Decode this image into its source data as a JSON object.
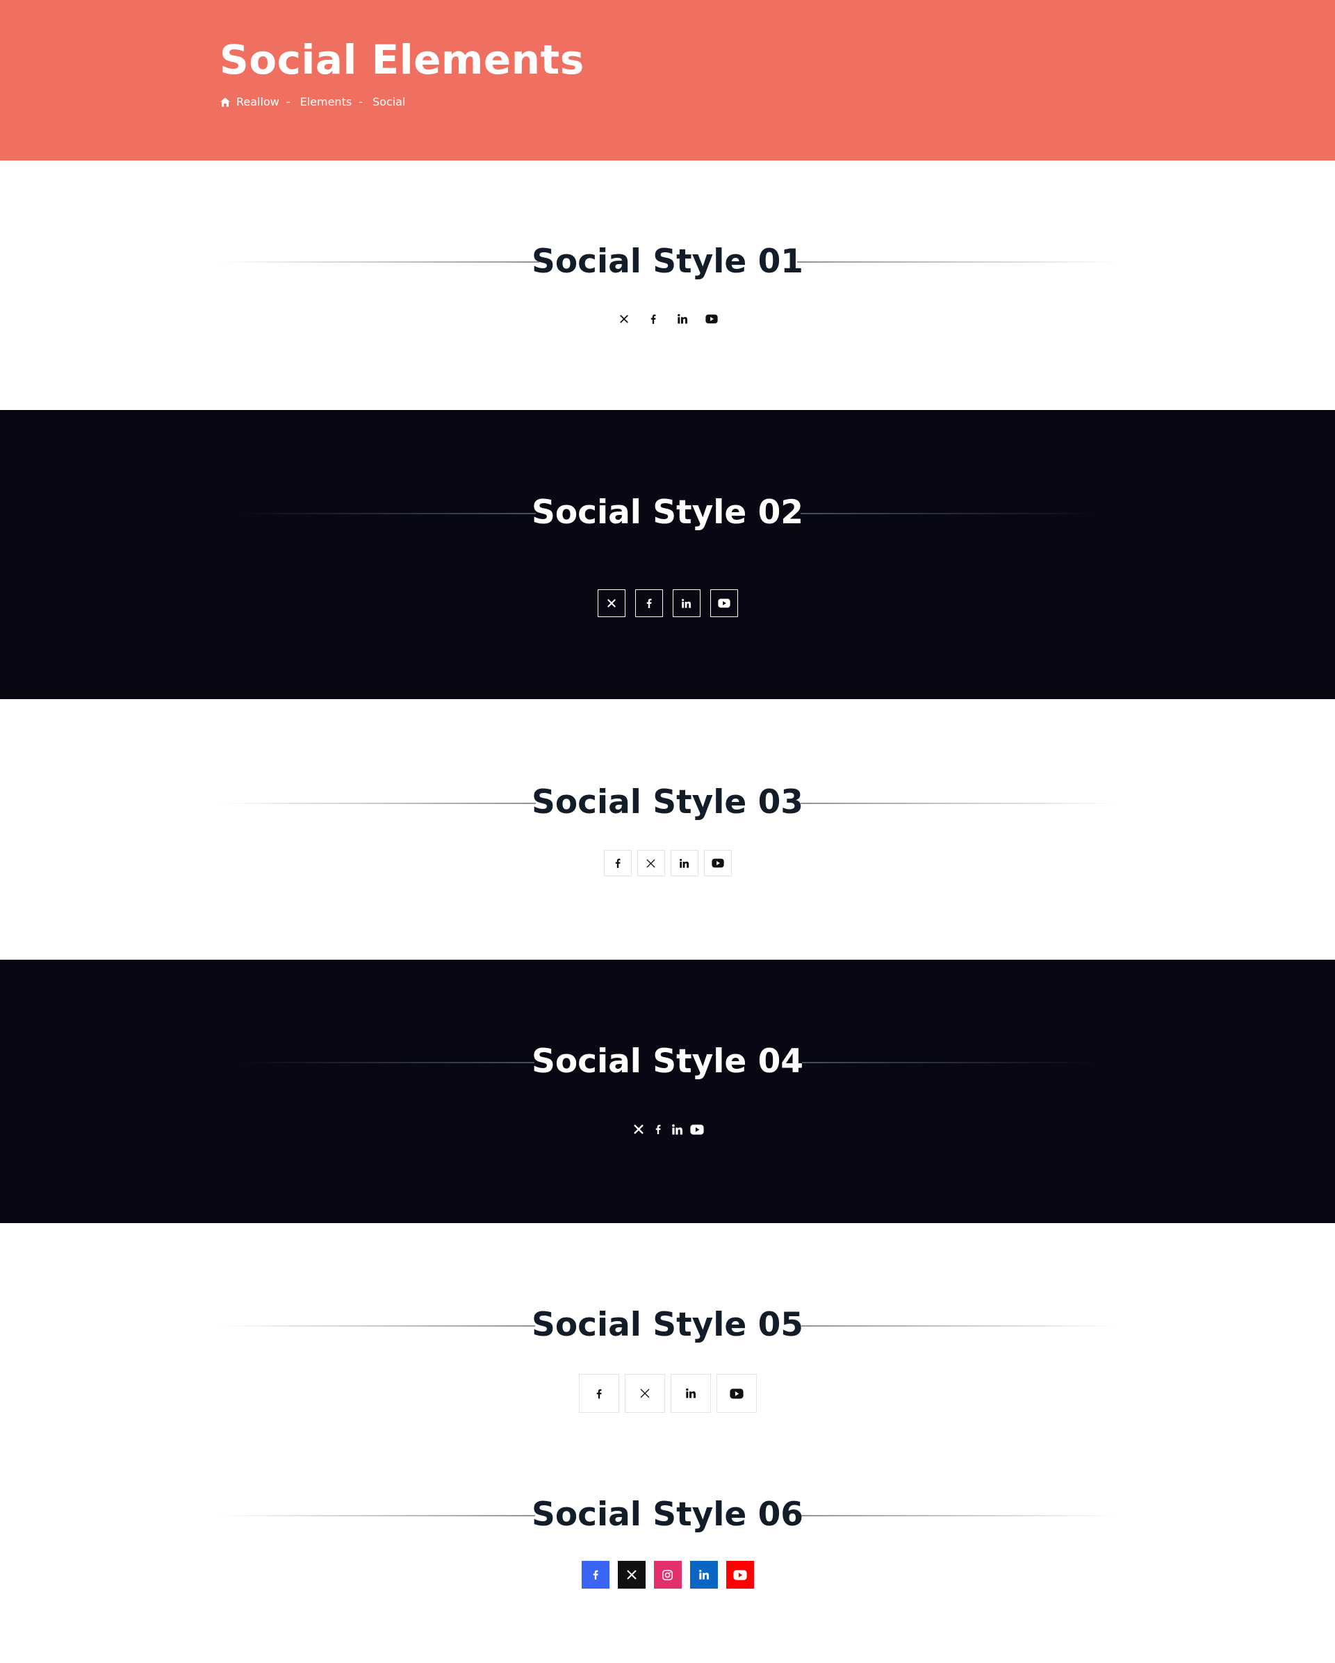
{
  "header": {
    "title": "Social Elements",
    "breadcrumb": {
      "home_icon": "home-icon",
      "items": [
        "Reallow",
        "Elements",
        "Social"
      ],
      "separator": "-"
    },
    "background": "#ef7060"
  },
  "sections": [
    {
      "title": "Social Style 01",
      "theme": "light",
      "icons": [
        "x-icon",
        "facebook-icon",
        "linkedin-icon",
        "youtube-icon"
      ]
    },
    {
      "title": "Social Style 02",
      "theme": "dark",
      "icons": [
        "x-icon",
        "facebook-icon",
        "linkedin-icon",
        "youtube-icon"
      ]
    },
    {
      "title": "Social Style 03",
      "theme": "light",
      "icons": [
        "facebook-icon",
        "x-icon",
        "linkedin-icon",
        "youtube-icon"
      ]
    },
    {
      "title": "Social Style 04",
      "theme": "dark",
      "icons": [
        "x-icon",
        "facebook-icon",
        "linkedin-icon",
        "youtube-icon"
      ]
    },
    {
      "title": "Social Style 05",
      "theme": "light",
      "icons": [
        "facebook-icon",
        "x-icon",
        "linkedin-icon",
        "youtube-icon"
      ]
    },
    {
      "title": "Social Style 06",
      "theme": "light",
      "icons": [
        "facebook-icon",
        "x-icon",
        "instagram-icon",
        "linkedin-icon",
        "youtube-icon"
      ]
    }
  ],
  "colors": {
    "accent": "#ef7060",
    "dark_bg": "#080815",
    "heading": "#131d2a",
    "facebook": "#3b66f5",
    "x": "#111111",
    "instagram": "#e1306c",
    "linkedin": "#0a66c2",
    "youtube": "#ff0000"
  }
}
